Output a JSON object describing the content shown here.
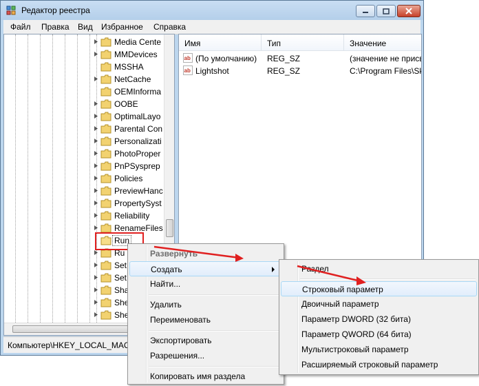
{
  "window": {
    "title": "Редактор реестра"
  },
  "menubar": [
    "Файл",
    "Правка",
    "Вид",
    "Избранное",
    "Справка"
  ],
  "tree": {
    "items": [
      "Media Cente",
      "MMDevices",
      "MSSHA",
      "NetCache",
      "OEMInforma",
      "OOBE",
      "OptimalLayo",
      "Parental Con",
      "Personalizati",
      "PhotoProper",
      "PnPSysprep",
      "Policies",
      "PreviewHanc",
      "PropertySyst",
      "Reliability",
      "RenameFiles",
      "Run",
      "Ru",
      "Set",
      "Set",
      "Sha",
      "She",
      "She"
    ],
    "selected": "Run"
  },
  "values": {
    "headers": [
      "Имя",
      "Тип",
      "Значение"
    ],
    "rows": [
      {
        "name": "(По умолчанию)",
        "type": "REG_SZ",
        "data": "(значение не присв"
      },
      {
        "name": "Lightshot",
        "type": "REG_SZ",
        "data": "C:\\Program Files\\Sk"
      }
    ]
  },
  "status": "Компьютер\\HKEY_LOCAL_MACI",
  "context_menu": {
    "items": [
      "Развернуть",
      "Создать",
      "Найти...",
      "Удалить",
      "Переименовать",
      "Экспортировать",
      "Разрешения...",
      "Копировать имя раздела"
    ]
  },
  "submenu": {
    "items": [
      "Раздел",
      "Строковый параметр",
      "Двоичный параметр",
      "Параметр DWORD (32 бита)",
      "Параметр QWORD (64 бита)",
      "Мультистроковый параметр",
      "Расширяемый строковый параметр"
    ]
  },
  "colors": {
    "accent_red": "#e02020",
    "highlight_border": "#a8d8f6"
  }
}
